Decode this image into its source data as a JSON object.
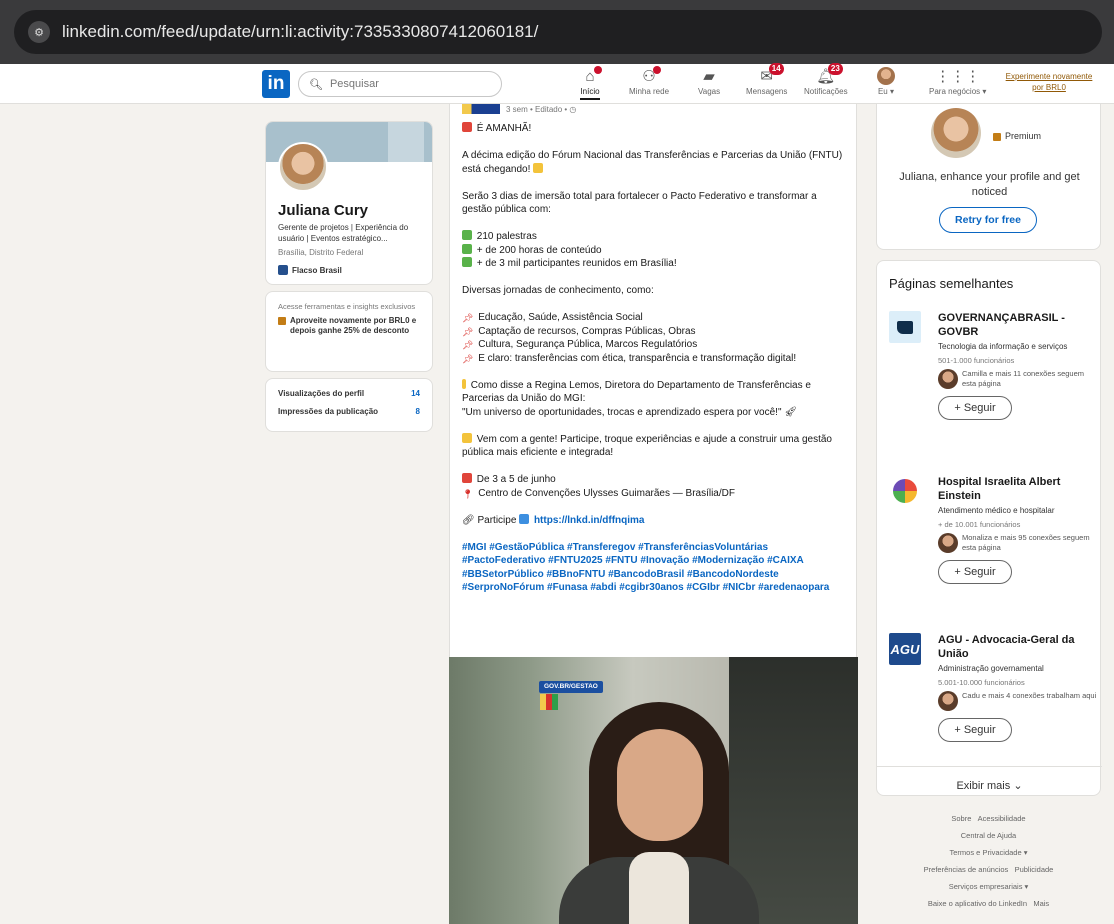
{
  "browser": {
    "url": "linkedin.com/feed/update/urn:li:activity:7335330807412060181/",
    "site_icon": "tune-icon"
  },
  "nav": {
    "logo": "in",
    "search_placeholder": "Pesquisar",
    "items": [
      {
        "label": "Início",
        "icon": "home-icon",
        "badge": ""
      },
      {
        "label": "Minha rede",
        "icon": "network-icon",
        "badge": ""
      },
      {
        "label": "Vagas",
        "icon": "briefcase-icon",
        "badge": ""
      },
      {
        "label": "Mensagens",
        "icon": "message-icon",
        "badge": "14"
      },
      {
        "label": "Notificações",
        "icon": "bell-icon",
        "badge": "23"
      },
      {
        "label": "Eu",
        "icon": "avatar",
        "badge": ""
      },
      {
        "label": "Para negócios",
        "icon": "grid-icon",
        "badge": ""
      }
    ],
    "premium_cta": "Experimente novamente por BRL0"
  },
  "profile": {
    "name": "Juliana Cury",
    "headline": "Gerente de projetos | Experiência do usuário | Eventos estratégico...",
    "location": "Brasília, Distrito Federal",
    "company": "Flacso Brasil"
  },
  "premium_card": {
    "hint": "Acesse ferramentas e insights exclusivos",
    "offer": "Aproveite novamente por BRL0 e depois ganhe 25% de desconto"
  },
  "stats": [
    {
      "label": "Visualizações do perfil",
      "value": "14"
    },
    {
      "label": "Impressões da publicação",
      "value": "8"
    }
  ],
  "post": {
    "meta": "3 sem • Editado •",
    "headline": "É AMANHÃ!",
    "p1": "A décima edição do Fórum Nacional das Transferências e Parcerias da União (FNTU) está chegando!",
    "p2": "Serão 3 dias de imersão total para fortalecer o Pacto Federativo e transformar a gestão pública com:",
    "bullets": [
      "210 palestras",
      "+ de 200 horas de conteúdo",
      "+ de 3 mil participantes reunidos em Brasília!"
    ],
    "p3": "Diversas jornadas de conhecimento, como:",
    "topics": [
      "Educação, Saúde, Assistência Social",
      "Captação de recursos, Compras Públicas, Obras",
      "Cultura, Segurança Pública, Marcos Regulatórios",
      "E claro: transferências com ética, transparência e transformação digital!"
    ],
    "quote_intro": "Como disse a Regina Lemos, Diretora do Departamento de Transferências e Parcerias da União do MGI:",
    "quote": "\"Um universo de oportunidades, trocas e aprendizado espera por você!\"",
    "cta": "Vem com a gente! Participe, troque experiências e ajude a construir uma gestão pública mais eficiente e integrada!",
    "date": "De 3 a 5 de junho",
    "place": "Centro de Convenções Ulysses Guimarães — Brasília/DF",
    "participe_label": "Participe",
    "link": "https://lnkd.in/dffnqima",
    "hashtags": "#MGI #GestãoPública #Transferegov #TransferênciasVoluntárias #PactoFederativo #FNTU2025 #FNTU #Inovação #Modernização #CAIXA #BBSetorPúblico #BBnoFNTU #BancodoBrasil #BancodoNordeste #SerproNoFórum #Funasa #abdi #cgibr30anos #CGIbr #NICbr #aredenaopara",
    "video_tag": "GOV.BR/GESTAO"
  },
  "right_top": {
    "premium_label": "Premium",
    "text": "Juliana, enhance your profile and get noticed",
    "button": "Retry for free"
  },
  "similar_pages": {
    "title": "Páginas semelhantes",
    "pages": [
      {
        "name": "GOVERNANÇABRASIL - GOVBR",
        "category": "Tecnologia da informação e serviços",
        "size": "501-1.000 funcionários",
        "connections": "Camilla e mais 11 conexões seguem esta página",
        "follow": "+ Seguir"
      },
      {
        "name": "Hospital Israelita Albert Einstein",
        "category": "Atendimento médico e hospitalar",
        "size": "+ de 10.001 funcionários",
        "connections": "Monaliza e mais 95 conexões seguem esta página",
        "follow": "+ Seguir"
      },
      {
        "name": "AGU - Advocacia-Geral da União",
        "category": "Administração governamental",
        "size": "5.001-10.000 funcionários",
        "connections": "Cadu e mais 4 conexões trabalham aqui",
        "follow": "+ Seguir",
        "logo_text": "AGU"
      }
    ],
    "show_more": "Exibir mais"
  },
  "footer": {
    "row1": [
      "Sobre",
      "Acessibilidade"
    ],
    "row2": "Central de Ajuda",
    "row3": "Termos e Privacidade ▾",
    "row4": [
      "Preferências de anúncios",
      "Publicidade"
    ],
    "row5": "Serviços empresariais ▾",
    "row6": [
      "Baixe o aplicativo do LinkedIn",
      "Mais"
    ]
  },
  "colors": {
    "brand": "#0a66c2",
    "badge": "#cb112d",
    "premium": "#915907",
    "page_bg": "#f4f2ee"
  }
}
